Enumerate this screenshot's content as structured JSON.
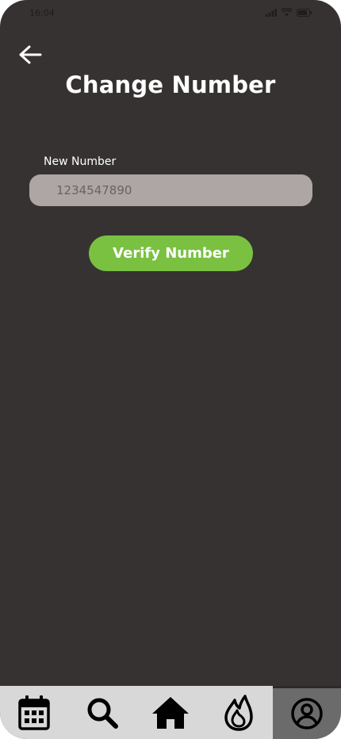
{
  "status_bar": {
    "time": "16:04",
    "icons": [
      "signal-icon",
      "wifi-icon",
      "battery-icon"
    ]
  },
  "header": {
    "back_icon": "arrow-left-icon",
    "title": "Change Number"
  },
  "form": {
    "label": "New Number",
    "phone_value": "1234547890"
  },
  "actions": {
    "verify_label": "Verify Number"
  },
  "bottom_nav": {
    "items": [
      {
        "name": "calendar-icon",
        "active": false
      },
      {
        "name": "search-icon",
        "active": false
      },
      {
        "name": "home-icon",
        "active": false
      },
      {
        "name": "flame-icon",
        "active": false
      },
      {
        "name": "profile-icon",
        "active": true
      }
    ]
  },
  "colors": {
    "background": "#363232",
    "input_background": "#aea5a5",
    "accent_green": "#7ac142",
    "nav_background": "#d8d8d8",
    "nav_active": "#6b6b6b"
  }
}
